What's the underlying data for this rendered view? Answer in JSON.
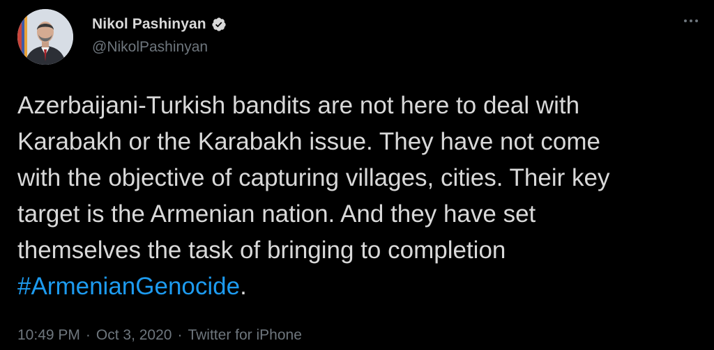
{
  "user": {
    "display_name": "Nikol Pashinyan",
    "handle": "@NikolPashinyan",
    "verified": true,
    "avatar_icon": "person-avatar-icon"
  },
  "tweet": {
    "lines": [
      "Azerbaijani-Turkish bandits are not here to deal with",
      "Karabakh or the Karabakh issue. They have not come",
      "with the objective of capturing villages, cities. Their key",
      "target is the Armenian nation. And they have set",
      "themselves the task of bringing to completion"
    ],
    "hashtag": "#ArmenianGenocide",
    "trailing": "."
  },
  "meta": {
    "time": "10:49 PM",
    "date": "Oct 3, 2020",
    "source": "Twitter for iPhone",
    "separator": "·"
  },
  "colors": {
    "background": "#000000",
    "text": "#d9d9d9",
    "secondary": "#6e767d",
    "link": "#1d9bf0"
  }
}
